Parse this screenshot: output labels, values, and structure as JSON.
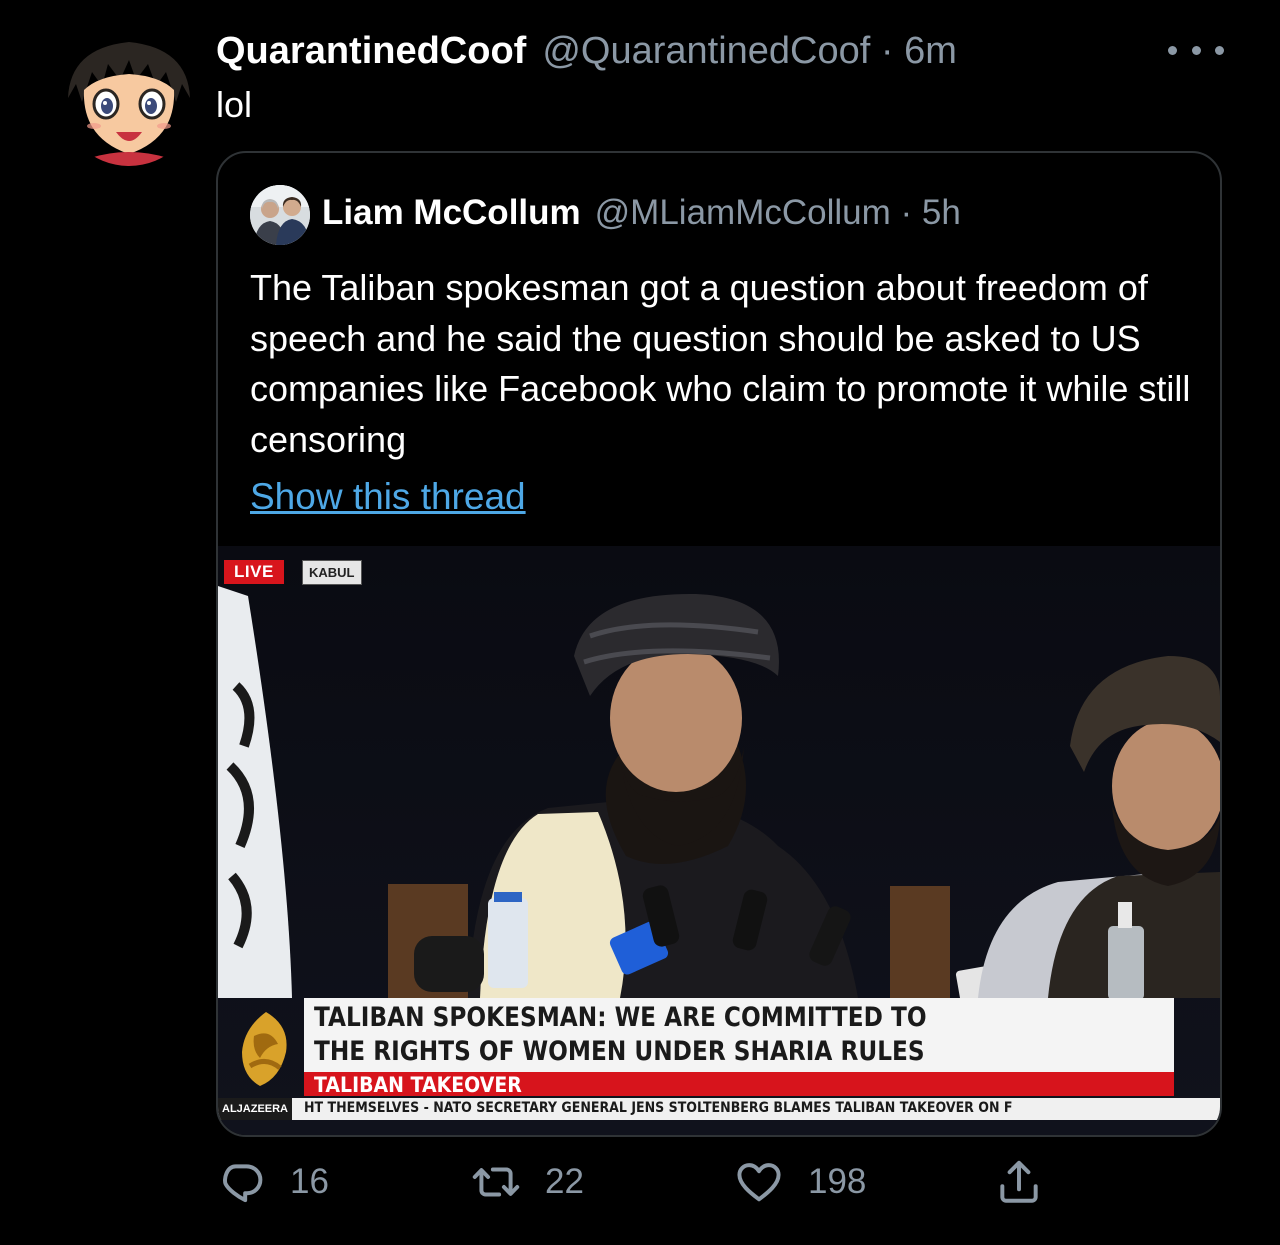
{
  "tweet": {
    "display_name": "QuarantinedCoof",
    "handle": "@QuarantinedCoof",
    "time": "6m",
    "text": "lol",
    "avatar_icon": "anime-character-avatar"
  },
  "quoted_tweet": {
    "display_name": "Liam McCollum",
    "handle": "@MLiamMcCollum",
    "time": "5h",
    "text": "The Taliban spokesman got a question about freedom of speech and he said the question should be asked to US companies like Facebook who claim to promote it while still censoring",
    "thread_link": "Show this thread",
    "avatar_icon": "two-people-photo-avatar",
    "media": {
      "live_badge": "LIVE",
      "location_badge": "KABUL",
      "headline_line1": "TALIBAN SPOKESMAN: WE ARE COMMITTED TO",
      "headline_line2": "THE RIGHTS OF WOMEN UNDER SHARIA RULES",
      "category": "TALIBAN TAKEOVER",
      "ticker_brand": "ALJAZEERA",
      "ticker_text": "HT THEMSELVES  -  NATO SECRETARY GENERAL JENS STOLTENBERG BLAMES TALIBAN TAKEOVER ON F"
    }
  },
  "actions": {
    "replies": "16",
    "retweets": "22",
    "likes": "198"
  },
  "colors": {
    "background": "#000000",
    "text_primary": "#ffffff",
    "text_secondary": "#8b98a5",
    "link": "#4ea8e6",
    "border": "#2f3336",
    "news_red": "#d7141c"
  }
}
